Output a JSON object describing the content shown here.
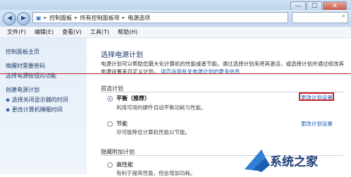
{
  "window": {
    "minimize": "—",
    "maximize": "☐",
    "close": "✕"
  },
  "address": {
    "crumbs": [
      "控制面板",
      "所有控制面板项",
      "电源选项"
    ],
    "separator": "▸"
  },
  "menu": [
    "文件(F)",
    "编辑(E)",
    "查看(V)",
    "工具(T)",
    "帮助(H)"
  ],
  "sidebar": [
    "控制面板主页",
    "唤醒时需要密码",
    "选择电源按钮的功能",
    "创建电源计划",
    "选择关闭显示器的时间",
    "更改计算机睡眠时间"
  ],
  "main": {
    "title": "选择电源计划",
    "desc_line1": "电源计划可以帮助您最大化计算机的性能或者节能。通过选择计划来将其激活，或选择计划并通过修改其",
    "desc_line2": "电源设置来自定义计划。",
    "desc_link": "请告诉我有关电源计划的更多信息",
    "preferred_label": "首选计划",
    "hidden_label": "隐藏附加计划",
    "plans": [
      {
        "name": "平衡（推荐）",
        "desc": "利用可用的硬件自动平衡功耗与性能。",
        "link": "更改计划设置"
      },
      {
        "name": "节能",
        "desc": "尽可能降低计算机性能以节能。",
        "link": "更改计划设置"
      },
      {
        "name": "高性能",
        "desc": "有利于提高性能，但会增加功耗。",
        "link": ""
      }
    ]
  },
  "watermark": {
    "text": "系统之家"
  }
}
